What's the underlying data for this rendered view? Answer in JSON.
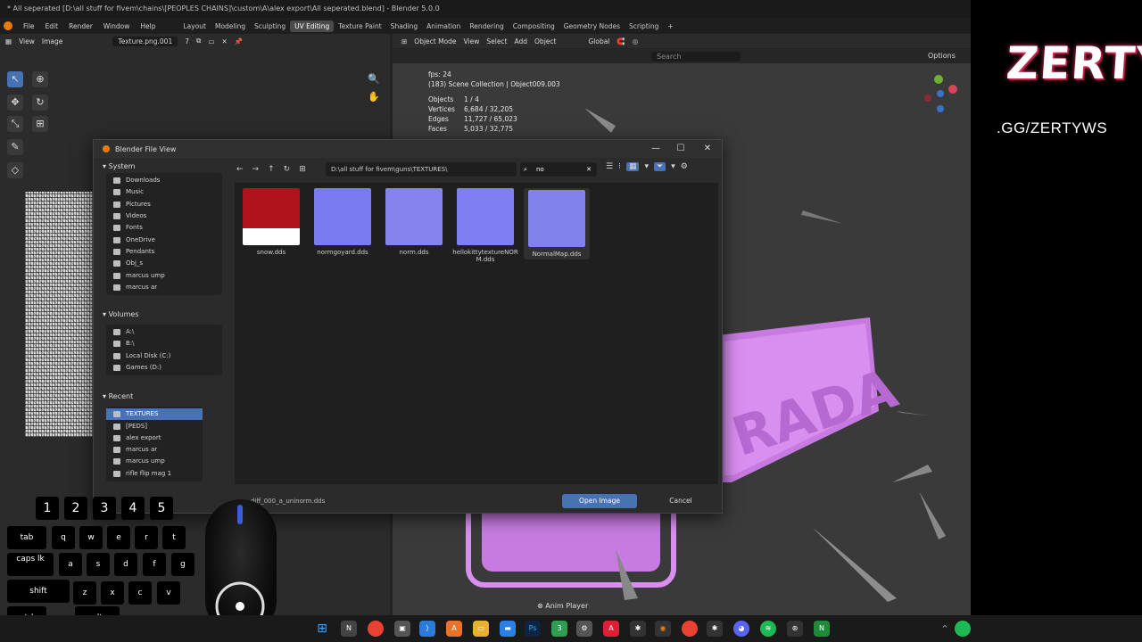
{
  "window_title": "* All seperated [D:\\all stuff for fivem\\chains\\[PEOPLES CHAINS]\\custom\\A\\alex export\\All seperated.blend] - Blender 5.0.0",
  "menu": [
    "File",
    "Edit",
    "Render",
    "Window",
    "Help"
  ],
  "workspaces": [
    "Layout",
    "Modeling",
    "Sculpting",
    "UV Editing",
    "Texture Paint",
    "Shading",
    "Animation",
    "Rendering",
    "Compositing",
    "Geometry Nodes",
    "Scripting"
  ],
  "active_workspace": "UV Editing",
  "image_editor": {
    "view": "View",
    "image": "Image",
    "image_name": "Texture.png.001",
    "users": "7"
  },
  "viewport": {
    "mode": "Object Mode",
    "menu": [
      "View",
      "Select",
      "Add",
      "Object"
    ],
    "orientation": "Global",
    "search_placeholder": "Search",
    "options": "Options",
    "stats": {
      "fps": "fps: 24",
      "collection": "(183) Scene Collection | Object009.003",
      "rows": [
        {
          "k": "Objects",
          "v": "1 / 4"
        },
        {
          "k": "Vertices",
          "v": "6,684 / 32,205"
        },
        {
          "k": "Edges",
          "v": "11,727 / 65,023"
        },
        {
          "k": "Faces",
          "v": "5,033 / 32,775"
        }
      ]
    }
  },
  "dialog": {
    "title": "Blender File View",
    "path": "D:\\all stuff for fivem\\guns\\TEXTURES\\",
    "search": "no",
    "system_label": "System",
    "system": [
      "Downloads",
      "Music",
      "Pictures",
      "Videos",
      "Fonts",
      "OneDrive",
      "Pendants",
      "Obj_s",
      "marcus ump",
      "marcus ar"
    ],
    "volumes_label": "Volumes",
    "volumes": [
      "A:\\",
      "B:\\",
      "Local Disk (C:)",
      "Games (D:)"
    ],
    "recent_label": "Recent",
    "recent": [
      "TEXTURES",
      "[PEDS]",
      "alex export",
      "marcus ar",
      "marcus ump",
      "rifle flip mag 1"
    ],
    "files": [
      {
        "name": "snow.dds",
        "color": "#b0131b"
      },
      {
        "name": "normgoyard.dds",
        "color": "#7a7bf0"
      },
      {
        "name": "norm.dds",
        "color": "#8584ee"
      },
      {
        "name": "hellokittytextureNORM.dds",
        "color": "#7f7ff3"
      },
      {
        "name": "NormalMap.dds",
        "color": "#8181ec"
      }
    ],
    "filename": "diff_000_a_uninorm.dds",
    "open_label": "Open Image",
    "cancel_label": "Cancel"
  },
  "overlay": {
    "brand": "ZERTY",
    "link": ".GG/ZERTYWS",
    "numbers": [
      "1",
      "2",
      "3",
      "4",
      "5"
    ],
    "row1": [
      "tab",
      "q",
      "w",
      "e",
      "r",
      "t"
    ],
    "row2": [
      "caps lk",
      "a",
      "s",
      "d",
      "f",
      "g"
    ],
    "row3": [
      "shift",
      "z",
      "x",
      "c",
      "v"
    ],
    "row4": [
      "ctrl",
      "alt"
    ]
  },
  "statusbar": {
    "anim_player": "Anim Player"
  }
}
